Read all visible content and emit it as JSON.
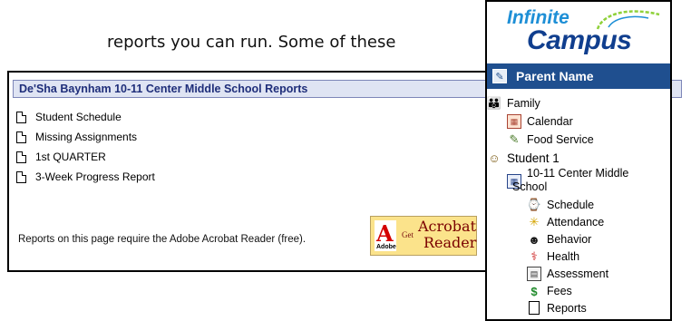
{
  "document": {
    "text": "reports you can run.  Some of these"
  },
  "reports_panel": {
    "title": "De'Sha Baynham 10-11 Center Middle School Reports",
    "items": [
      {
        "label": "Student Schedule"
      },
      {
        "label": "Missing Assignments"
      },
      {
        "label": "1st QUARTER"
      },
      {
        "label": "3-Week Progress Report"
      }
    ],
    "footer": "Reports on this page require the Adobe Acrobat Reader (free).",
    "acrobat_badge": {
      "adobe_word": "Adobe",
      "get_label": "Get",
      "product_line1": "Acrobat",
      "product_line2": "Reader"
    }
  },
  "sidebar": {
    "logo": {
      "line1": "Infinite",
      "line2": "Campus"
    },
    "header_label": "Parent Name",
    "items": [
      {
        "label": "Family",
        "icon": "family-icon"
      },
      {
        "label": "Calendar",
        "icon": "calendar-icon"
      },
      {
        "label": "Food Service",
        "icon": "food-service-icon"
      },
      {
        "label": "Student 1",
        "icon": "student-icon"
      },
      {
        "label": "10-11 Center Middle",
        "label2": "School",
        "icon": "school-icon"
      },
      {
        "label": "Schedule",
        "icon": "schedule-icon"
      },
      {
        "label": "Attendance",
        "icon": "attendance-icon"
      },
      {
        "label": "Behavior",
        "icon": "behavior-icon"
      },
      {
        "label": "Health",
        "icon": "health-icon"
      },
      {
        "label": "Assessment",
        "icon": "assessment-icon"
      },
      {
        "label": "Fees",
        "icon": "fees-icon"
      },
      {
        "label": "Reports",
        "icon": "reports-icon"
      }
    ]
  },
  "colors": {
    "header_bg": "#1f4f8f",
    "reports_title_bg": "#dfe4f3",
    "reports_title_text": "#1f2e7a",
    "logo_infinite": "#1e8fd6",
    "logo_campus": "#103e8e"
  }
}
